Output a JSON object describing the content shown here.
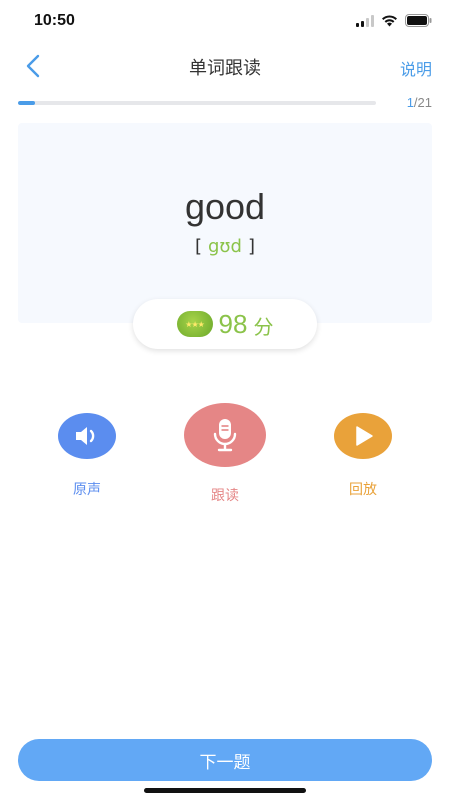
{
  "status_bar": {
    "time": "10:50"
  },
  "nav": {
    "title": "单词跟读",
    "help_label": "说明"
  },
  "progress": {
    "current": "1",
    "total": "/21",
    "fraction": 0.048
  },
  "word": {
    "text": "good",
    "phonetic_open": "[",
    "phonetic": "gʊd",
    "phonetic_close": "]"
  },
  "score": {
    "value": "98",
    "unit": "分",
    "stars": "★★★"
  },
  "actions": {
    "original_label": "原声",
    "follow_label": "跟读",
    "playback_label": "回放"
  },
  "footer": {
    "next_label": "下一题"
  },
  "colors": {
    "accent": "#4a9ce8",
    "score_green": "#8bc34a",
    "original_blue": "#5b8def",
    "follow_red": "#e58686",
    "playback_orange": "#e9a23a",
    "next_button": "#62a8f5"
  },
  "icons": {
    "back": "chevron-left-icon",
    "original": "speaker-icon",
    "follow": "microphone-icon",
    "playback": "play-icon",
    "signal": "signal-icon",
    "wifi": "wifi-icon",
    "battery": "battery-icon"
  }
}
